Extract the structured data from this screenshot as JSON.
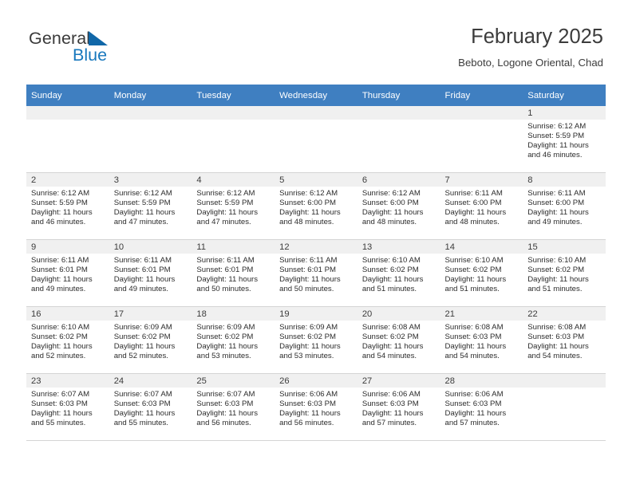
{
  "brand": {
    "name_part1": "General",
    "name_part2": "Blue",
    "flag_icon": "triangle-flag-icon",
    "accent_color": "#1878bd"
  },
  "header": {
    "title": "February 2025",
    "subtitle": "Beboto, Logone Oriental, Chad"
  },
  "calendar": {
    "header_color": "#3f7fc1",
    "weekday_headers": [
      "Sunday",
      "Monday",
      "Tuesday",
      "Wednesday",
      "Thursday",
      "Friday",
      "Saturday"
    ],
    "weeks": [
      [
        {
          "day": "",
          "sunrise": "",
          "sunset": "",
          "daylight_line1": "",
          "daylight_line2": ""
        },
        {
          "day": "",
          "sunrise": "",
          "sunset": "",
          "daylight_line1": "",
          "daylight_line2": ""
        },
        {
          "day": "",
          "sunrise": "",
          "sunset": "",
          "daylight_line1": "",
          "daylight_line2": ""
        },
        {
          "day": "",
          "sunrise": "",
          "sunset": "",
          "daylight_line1": "",
          "daylight_line2": ""
        },
        {
          "day": "",
          "sunrise": "",
          "sunset": "",
          "daylight_line1": "",
          "daylight_line2": ""
        },
        {
          "day": "",
          "sunrise": "",
          "sunset": "",
          "daylight_line1": "",
          "daylight_line2": ""
        },
        {
          "day": "1",
          "sunrise": "Sunrise: 6:12 AM",
          "sunset": "Sunset: 5:59 PM",
          "daylight_line1": "Daylight: 11 hours",
          "daylight_line2": "and 46 minutes."
        }
      ],
      [
        {
          "day": "2",
          "sunrise": "Sunrise: 6:12 AM",
          "sunset": "Sunset: 5:59 PM",
          "daylight_line1": "Daylight: 11 hours",
          "daylight_line2": "and 46 minutes."
        },
        {
          "day": "3",
          "sunrise": "Sunrise: 6:12 AM",
          "sunset": "Sunset: 5:59 PM",
          "daylight_line1": "Daylight: 11 hours",
          "daylight_line2": "and 47 minutes."
        },
        {
          "day": "4",
          "sunrise": "Sunrise: 6:12 AM",
          "sunset": "Sunset: 5:59 PM",
          "daylight_line1": "Daylight: 11 hours",
          "daylight_line2": "and 47 minutes."
        },
        {
          "day": "5",
          "sunrise": "Sunrise: 6:12 AM",
          "sunset": "Sunset: 6:00 PM",
          "daylight_line1": "Daylight: 11 hours",
          "daylight_line2": "and 48 minutes."
        },
        {
          "day": "6",
          "sunrise": "Sunrise: 6:12 AM",
          "sunset": "Sunset: 6:00 PM",
          "daylight_line1": "Daylight: 11 hours",
          "daylight_line2": "and 48 minutes."
        },
        {
          "day": "7",
          "sunrise": "Sunrise: 6:11 AM",
          "sunset": "Sunset: 6:00 PM",
          "daylight_line1": "Daylight: 11 hours",
          "daylight_line2": "and 48 minutes."
        },
        {
          "day": "8",
          "sunrise": "Sunrise: 6:11 AM",
          "sunset": "Sunset: 6:00 PM",
          "daylight_line1": "Daylight: 11 hours",
          "daylight_line2": "and 49 minutes."
        }
      ],
      [
        {
          "day": "9",
          "sunrise": "Sunrise: 6:11 AM",
          "sunset": "Sunset: 6:01 PM",
          "daylight_line1": "Daylight: 11 hours",
          "daylight_line2": "and 49 minutes."
        },
        {
          "day": "10",
          "sunrise": "Sunrise: 6:11 AM",
          "sunset": "Sunset: 6:01 PM",
          "daylight_line1": "Daylight: 11 hours",
          "daylight_line2": "and 49 minutes."
        },
        {
          "day": "11",
          "sunrise": "Sunrise: 6:11 AM",
          "sunset": "Sunset: 6:01 PM",
          "daylight_line1": "Daylight: 11 hours",
          "daylight_line2": "and 50 minutes."
        },
        {
          "day": "12",
          "sunrise": "Sunrise: 6:11 AM",
          "sunset": "Sunset: 6:01 PM",
          "daylight_line1": "Daylight: 11 hours",
          "daylight_line2": "and 50 minutes."
        },
        {
          "day": "13",
          "sunrise": "Sunrise: 6:10 AM",
          "sunset": "Sunset: 6:02 PM",
          "daylight_line1": "Daylight: 11 hours",
          "daylight_line2": "and 51 minutes."
        },
        {
          "day": "14",
          "sunrise": "Sunrise: 6:10 AM",
          "sunset": "Sunset: 6:02 PM",
          "daylight_line1": "Daylight: 11 hours",
          "daylight_line2": "and 51 minutes."
        },
        {
          "day": "15",
          "sunrise": "Sunrise: 6:10 AM",
          "sunset": "Sunset: 6:02 PM",
          "daylight_line1": "Daylight: 11 hours",
          "daylight_line2": "and 51 minutes."
        }
      ],
      [
        {
          "day": "16",
          "sunrise": "Sunrise: 6:10 AM",
          "sunset": "Sunset: 6:02 PM",
          "daylight_line1": "Daylight: 11 hours",
          "daylight_line2": "and 52 minutes."
        },
        {
          "day": "17",
          "sunrise": "Sunrise: 6:09 AM",
          "sunset": "Sunset: 6:02 PM",
          "daylight_line1": "Daylight: 11 hours",
          "daylight_line2": "and 52 minutes."
        },
        {
          "day": "18",
          "sunrise": "Sunrise: 6:09 AM",
          "sunset": "Sunset: 6:02 PM",
          "daylight_line1": "Daylight: 11 hours",
          "daylight_line2": "and 53 minutes."
        },
        {
          "day": "19",
          "sunrise": "Sunrise: 6:09 AM",
          "sunset": "Sunset: 6:02 PM",
          "daylight_line1": "Daylight: 11 hours",
          "daylight_line2": "and 53 minutes."
        },
        {
          "day": "20",
          "sunrise": "Sunrise: 6:08 AM",
          "sunset": "Sunset: 6:02 PM",
          "daylight_line1": "Daylight: 11 hours",
          "daylight_line2": "and 54 minutes."
        },
        {
          "day": "21",
          "sunrise": "Sunrise: 6:08 AM",
          "sunset": "Sunset: 6:03 PM",
          "daylight_line1": "Daylight: 11 hours",
          "daylight_line2": "and 54 minutes."
        },
        {
          "day": "22",
          "sunrise": "Sunrise: 6:08 AM",
          "sunset": "Sunset: 6:03 PM",
          "daylight_line1": "Daylight: 11 hours",
          "daylight_line2": "and 54 minutes."
        }
      ],
      [
        {
          "day": "23",
          "sunrise": "Sunrise: 6:07 AM",
          "sunset": "Sunset: 6:03 PM",
          "daylight_line1": "Daylight: 11 hours",
          "daylight_line2": "and 55 minutes."
        },
        {
          "day": "24",
          "sunrise": "Sunrise: 6:07 AM",
          "sunset": "Sunset: 6:03 PM",
          "daylight_line1": "Daylight: 11 hours",
          "daylight_line2": "and 55 minutes."
        },
        {
          "day": "25",
          "sunrise": "Sunrise: 6:07 AM",
          "sunset": "Sunset: 6:03 PM",
          "daylight_line1": "Daylight: 11 hours",
          "daylight_line2": "and 56 minutes."
        },
        {
          "day": "26",
          "sunrise": "Sunrise: 6:06 AM",
          "sunset": "Sunset: 6:03 PM",
          "daylight_line1": "Daylight: 11 hours",
          "daylight_line2": "and 56 minutes."
        },
        {
          "day": "27",
          "sunrise": "Sunrise: 6:06 AM",
          "sunset": "Sunset: 6:03 PM",
          "daylight_line1": "Daylight: 11 hours",
          "daylight_line2": "and 57 minutes."
        },
        {
          "day": "28",
          "sunrise": "Sunrise: 6:06 AM",
          "sunset": "Sunset: 6:03 PM",
          "daylight_line1": "Daylight: 11 hours",
          "daylight_line2": "and 57 minutes."
        },
        {
          "day": "",
          "sunrise": "",
          "sunset": "",
          "daylight_line1": "",
          "daylight_line2": ""
        }
      ]
    ]
  }
}
